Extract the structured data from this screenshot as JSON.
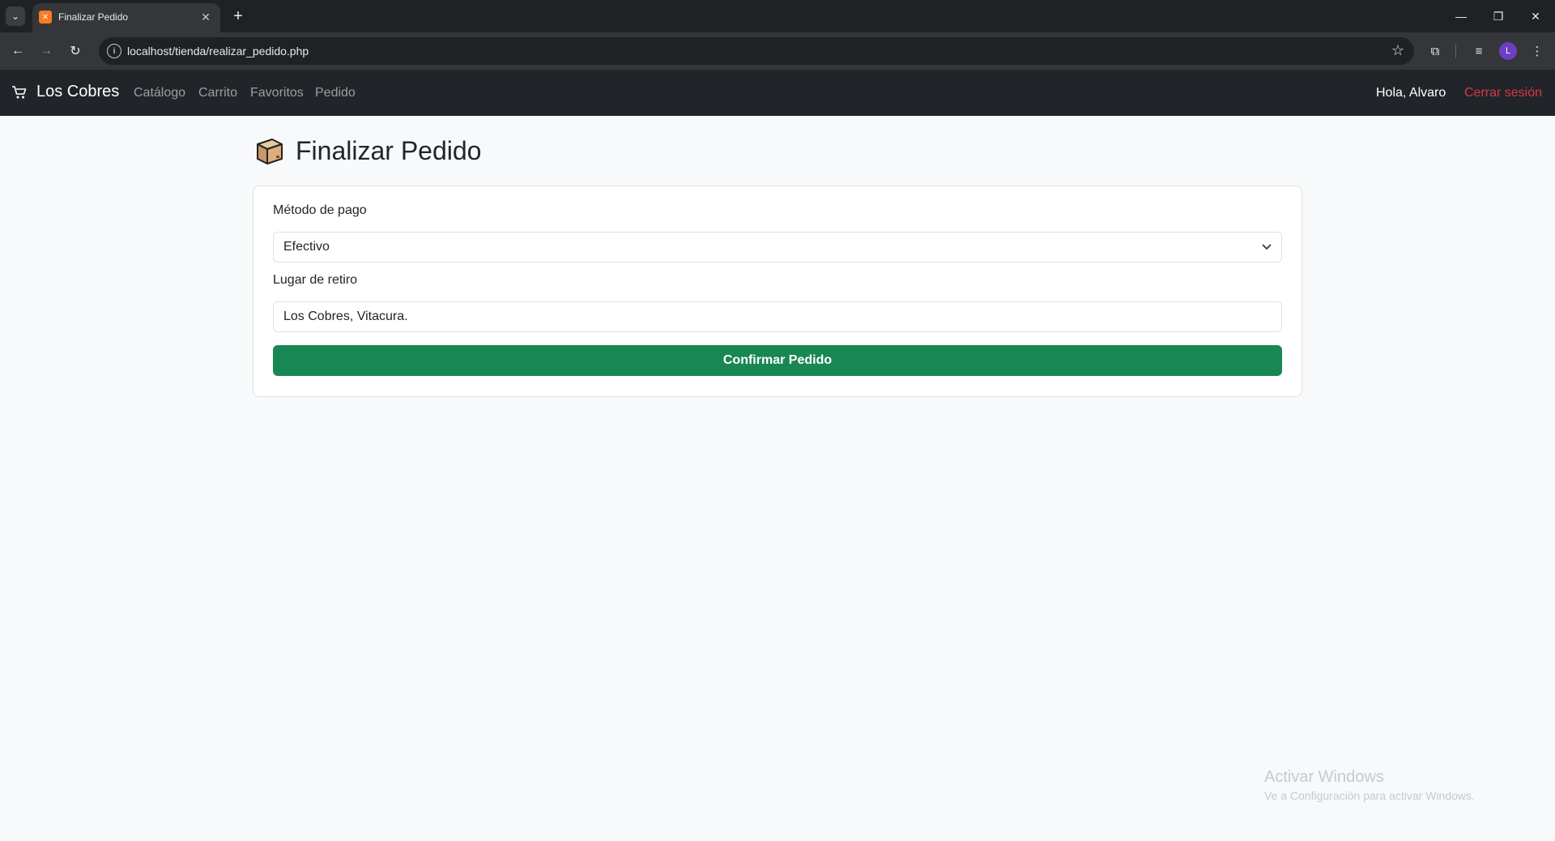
{
  "browser": {
    "tab_title": "Finalizar Pedido",
    "url": "localhost/tienda/realizar_pedido.php",
    "profile_initial": "L"
  },
  "navbar": {
    "brand": "Los Cobres",
    "links": [
      "Catálogo",
      "Carrito",
      "Favoritos",
      "Pedido"
    ],
    "greeting": "Hola, Alvaro",
    "logout": "Cerrar sesión"
  },
  "page": {
    "title": "Finalizar Pedido",
    "title_icon": "package-box-icon"
  },
  "form": {
    "payment_label": "Método de pago",
    "payment_value": "Efectivo",
    "pickup_label": "Lugar de retiro",
    "pickup_value": "Los Cobres, Vitacura.",
    "confirm_label": "Confirmar Pedido"
  },
  "watermark": {
    "title": "Activar Windows",
    "subtitle": "Ve a Configuración para activar Windows."
  },
  "colors": {
    "navbar_bg": "#212529",
    "confirm_button": "#198754",
    "logout_link": "#dc3545",
    "page_bg": "#f8f9fa"
  }
}
